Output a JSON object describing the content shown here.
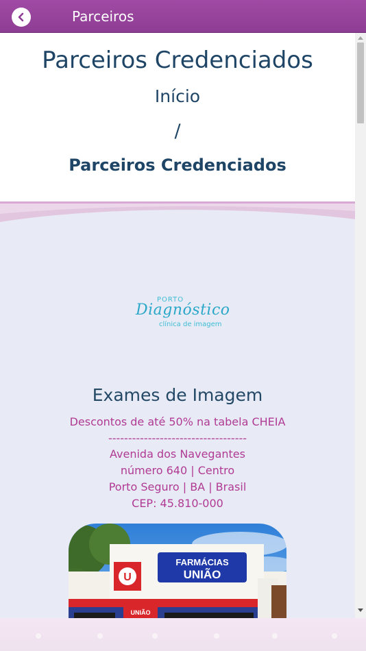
{
  "topbar": {
    "title": "Parceiros",
    "back_icon": "chevron-left-icon"
  },
  "hero": {
    "title": "Parceiros Credenciados",
    "crumb_home": "Início",
    "crumb_separator": "/",
    "crumb_current": "Parceiros Credenciados"
  },
  "partner": {
    "logo": {
      "porto": "PORTO",
      "main": "Diagnóstico",
      "sub": "clínica de imagem"
    },
    "title": "Exames de Imagem",
    "discount": "Descontos de até 50% na tabela CHEIA",
    "divider": "-----------------------------------",
    "address_line1": "Avenida dos Navegantes",
    "address_line2": "número 640 | Centro",
    "address_line3": "Porto Seguro | BA | Brasil",
    "address_line4": "CEP: 45.810-000",
    "photo": {
      "sign_line1": "FARMÁCIAS",
      "sign_line2": "UNIÃO",
      "sign_small": "UNIÃO"
    }
  },
  "colors": {
    "topbar": "#8e3d94",
    "title_text": "#1f4566",
    "accent_text": "#b03a94",
    "section_bg": "#e8ebf5"
  }
}
